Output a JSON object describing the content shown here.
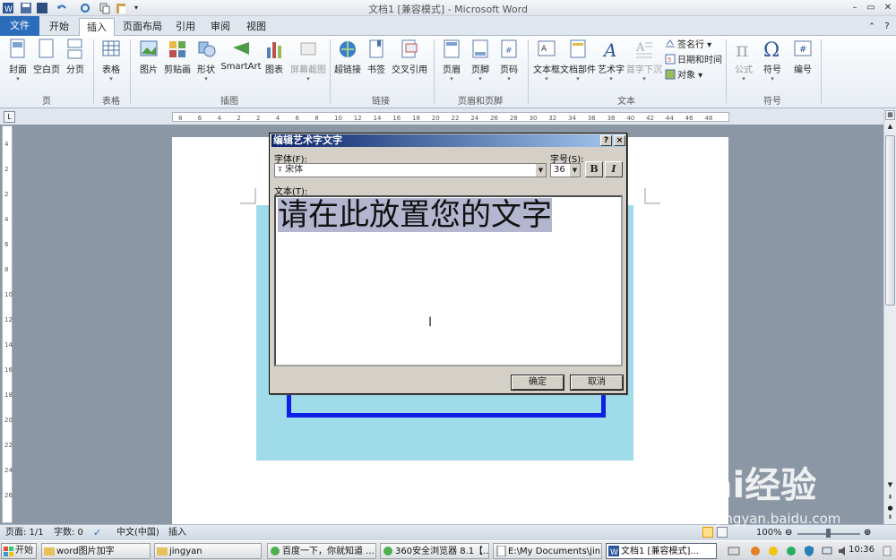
{
  "window": {
    "title": "文档1 [兼容模式] - Microsoft Word"
  },
  "tabs": [
    {
      "label": "文件"
    },
    {
      "label": "开始"
    },
    {
      "label": "插入"
    },
    {
      "label": "页面布局"
    },
    {
      "label": "引用"
    },
    {
      "label": "审阅"
    },
    {
      "label": "视图"
    }
  ],
  "ribbon": {
    "pages": {
      "cover": "封面",
      "blank": "空白页",
      "break": "分页",
      "group": "页"
    },
    "tables": {
      "table": "表格",
      "group": "表格"
    },
    "illustrations": {
      "picture": "图片",
      "clipart": "剪贴画",
      "shapes": "形状",
      "smartart": "SmartArt",
      "chart": "图表",
      "screenshot": "屏幕截图",
      "group": "插图"
    },
    "links": {
      "hyperlink": "超链接",
      "bookmark": "书签",
      "crossref": "交叉引用",
      "group": "链接"
    },
    "header_footer": {
      "header": "页眉",
      "footer": "页脚",
      "page_number": "页码",
      "group": "页眉和页脚"
    },
    "text": {
      "textbox": "文本框",
      "quickparts": "文档部件",
      "wordart": "艺术字",
      "dropcap": "首字下沉",
      "signature": "签名行",
      "datetime": "日期和时间",
      "object": "对象",
      "group": "文本"
    },
    "symbols": {
      "equation": "公式",
      "symbol": "符号",
      "number": "编号",
      "group": "符号"
    }
  },
  "ruler": {
    "h_labels": [
      "8",
      "6",
      "4",
      "2",
      "2",
      "4",
      "6",
      "8",
      "10",
      "12",
      "14",
      "16",
      "18",
      "20",
      "22",
      "24",
      "26",
      "28",
      "30",
      "32",
      "34",
      "36",
      "38",
      "40",
      "42",
      "44",
      "46",
      "48"
    ],
    "v_labels": [
      "4",
      "2",
      "2",
      "4",
      "6",
      "8",
      "10",
      "12",
      "14",
      "16",
      "18",
      "20",
      "22",
      "24",
      "26"
    ]
  },
  "dialog": {
    "title": "编辑艺术字文字",
    "help": "?",
    "close": "×",
    "font_label": "字体(F):",
    "font_value": "宋体",
    "size_label": "字号(S):",
    "size_value": "36",
    "bold": "B",
    "italic": "I",
    "text_label": "文本(T):",
    "text_value": "请在此放置您的文字",
    "ok": "确定",
    "cancel": "取消"
  },
  "statusbar": {
    "page": "页面: 1/1",
    "words": "字数: 0",
    "language": "中文(中国)",
    "mode": "插入",
    "zoom": "100%"
  },
  "taskbar": {
    "start": "开始",
    "items": [
      {
        "label": "word图片加字"
      },
      {
        "label": "jingyan"
      },
      {
        "label": "百度一下，你就知道 ..."
      },
      {
        "label": "360安全浏览器 8.1【..."
      },
      {
        "label": "E:\\My Documents\\jin..."
      },
      {
        "label": "文档1 [兼容模式]..."
      }
    ],
    "clock": "10:36"
  },
  "watermark": {
    "logo": "Bai经验",
    "url": "jingyan.baidu.com"
  },
  "colors": {
    "accent": "#2b6dbb",
    "wordart_box": "#9fdbe9",
    "frame": "#0f1fe8",
    "selection": "#b3b6ce"
  }
}
